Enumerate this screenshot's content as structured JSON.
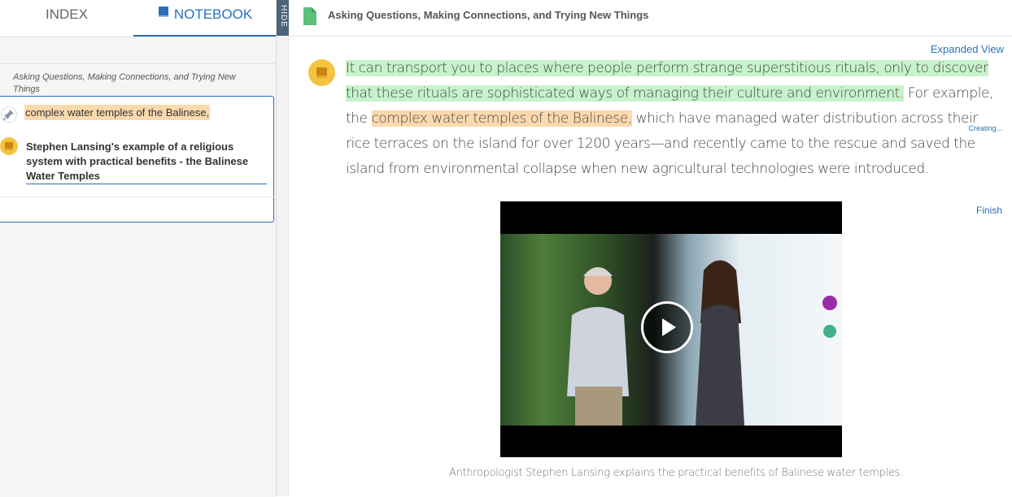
{
  "tabs": {
    "index_label": "INDEX",
    "notebook_label": "NOTEBOOK"
  },
  "sidebar": {
    "expanded_view_label": "Expanded View",
    "chapter_title": "Asking Questions, Making Connections, and Trying New Things",
    "note": {
      "quote": "complex water temples of the Balinese,",
      "status": "Creating...",
      "text": "Stephen Lansing's example of a religious system with practical benefits - the Balinese Water Temples",
      "finish_label": "Finish"
    }
  },
  "hide_label": "HIDE",
  "header": {
    "title": "Asking Questions, Making Connections, and Trying New Things"
  },
  "passage": {
    "part1_highlight_green": "It can transport you to places where people perform strange superstitious rituals, only to discover that these rituals are sophisticated ways of managing their culture and environment.",
    "part2": " For example, the ",
    "part3_highlight_orange": "complex water temples of the Balinese,",
    "part4": " which have managed water distribution across their rice terraces on the island for over 1200 years—and recently came to the rescue and saved the island from environmental collapse when new agricultural technologies were introduced."
  },
  "video": {
    "caption": "Anthropologist Stephen Lansing explains the practical benefits of Balinese water temples."
  },
  "colors": {
    "accent": "#2a6fba",
    "highlight_green": "#c7f3cb",
    "highlight_orange": "#fbd9ae",
    "note_yellow": "#f4c441",
    "hide_tab": "#4b6478",
    "doc_icon_green": "#5cbf7a"
  },
  "icons": [
    "book-icon",
    "pin-icon",
    "note-icon",
    "doc-icon",
    "play-icon"
  ]
}
